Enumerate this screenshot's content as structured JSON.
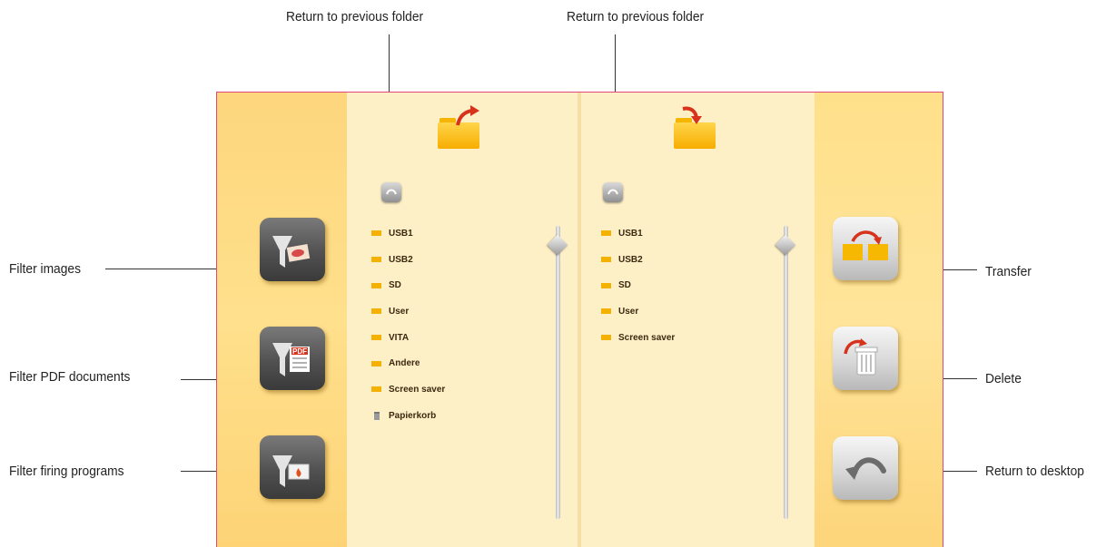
{
  "callouts": {
    "return_prev_left": "Return to previous folder",
    "return_prev_right": "Return to previous folder",
    "filter_images": "Filter images",
    "filter_pdf": "Filter PDF documents",
    "filter_firing": "Filter firing programs",
    "transfer": "Transfer",
    "delete": "Delete",
    "return_desktop": "Return to desktop"
  },
  "source_panel": {
    "icon": "folder-export-icon",
    "items": [
      "USB1",
      "USB2",
      "SD",
      "User",
      "VITA",
      "Andere",
      "Screen saver",
      "Papierkorb"
    ]
  },
  "target_panel": {
    "icon": "folder-import-icon",
    "items": [
      "USB1",
      "USB2",
      "SD",
      "User",
      "Screen saver"
    ]
  },
  "filter_buttons": {
    "images_icon": "filter-images-icon",
    "pdf_icon": "filter-pdf-icon",
    "pdf_text": "PDF",
    "firing_icon": "filter-firing-icon"
  },
  "action_buttons": {
    "transfer_icon": "transfer-icon",
    "delete_icon": "delete-icon",
    "desktop_icon": "return-arrow-icon"
  },
  "colors": {
    "frame_border": "#e0477a",
    "side_bg": "#fdd67d",
    "panel_bg": "#fdefc6",
    "folder": "#f4b100",
    "arrow_red": "#d6321c"
  }
}
